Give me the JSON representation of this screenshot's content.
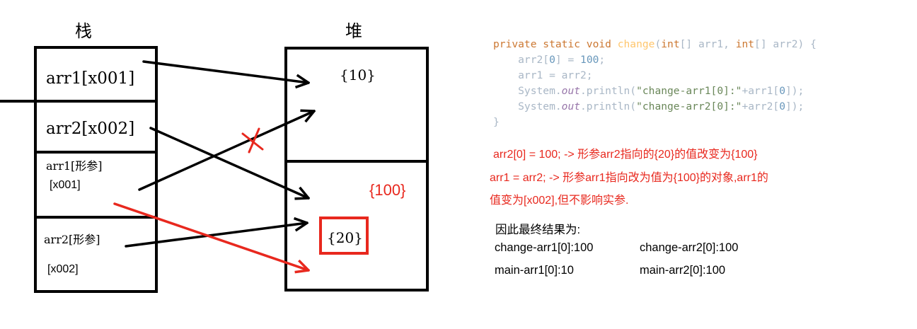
{
  "diagram": {
    "stack_title": "栈",
    "heap_title": "堆",
    "stack_cells": [
      {
        "name": "arr1",
        "addr": "[x001]"
      },
      {
        "name": "arr2",
        "addr": "[x002]"
      },
      {
        "name": "arr1[形参]",
        "addr": "[x001]"
      },
      {
        "name": "arr2[形参]",
        "addr": "[x002]"
      }
    ],
    "heap_objects": {
      "obj1": "{10}",
      "obj2_old": "{20}",
      "obj2_new": "{100}"
    },
    "cross_mark": "×",
    "colors": {
      "line": "#000000",
      "highlight": "#e8281e"
    }
  },
  "code": {
    "lines": [
      [
        {
          "t": "private static void ",
          "c": "kw"
        },
        {
          "t": "change",
          "c": "fn"
        },
        {
          "t": "(",
          "c": "pl"
        },
        {
          "t": "int",
          "c": "kw"
        },
        {
          "t": "[] arr1, ",
          "c": "pl"
        },
        {
          "t": "int",
          "c": "kw"
        },
        {
          "t": "[] arr2) {",
          "c": "pl"
        }
      ],
      [
        {
          "t": "    arr2[",
          "c": "pl"
        },
        {
          "t": "0",
          "c": "num"
        },
        {
          "t": "] = ",
          "c": "pl"
        },
        {
          "t": "100",
          "c": "num"
        },
        {
          "t": ";",
          "c": "pl"
        }
      ],
      [
        {
          "t": "    arr1 = arr2;",
          "c": "pl"
        }
      ],
      [
        {
          "t": "    System.",
          "c": "pl"
        },
        {
          "t": "out",
          "c": "it"
        },
        {
          "t": ".println(",
          "c": "pl"
        },
        {
          "t": "\"change-arr1[0]:\"",
          "c": "str"
        },
        {
          "t": "+arr1[",
          "c": "pl"
        },
        {
          "t": "0",
          "c": "num"
        },
        {
          "t": "]);",
          "c": "pl"
        }
      ],
      [
        {
          "t": "    System.",
          "c": "pl"
        },
        {
          "t": "out",
          "c": "it"
        },
        {
          "t": ".println(",
          "c": "pl"
        },
        {
          "t": "\"change-arr2[0]:\"",
          "c": "str"
        },
        {
          "t": "+arr2[",
          "c": "pl"
        },
        {
          "t": "0",
          "c": "num"
        },
        {
          "t": "]);",
          "c": "pl"
        }
      ],
      [
        {
          "t": "}",
          "c": "pl"
        }
      ]
    ]
  },
  "notes": {
    "line1": "arr2[0] = 100; -> 形参arr2指向的{20}的值改变为{100}",
    "line2": "arr1 = arr2; -> 形参arr1指向改为值为{100}的对象,arr1的",
    "line3": "值变为[x002],但不影响实参."
  },
  "result": {
    "title": "因此最终结果为:",
    "change_arr1": "change-arr1[0]:100",
    "change_arr2": "change-arr2[0]:100",
    "main_arr1": "main-arr1[0]:10",
    "main_arr2": "main-arr2[0]:100"
  }
}
